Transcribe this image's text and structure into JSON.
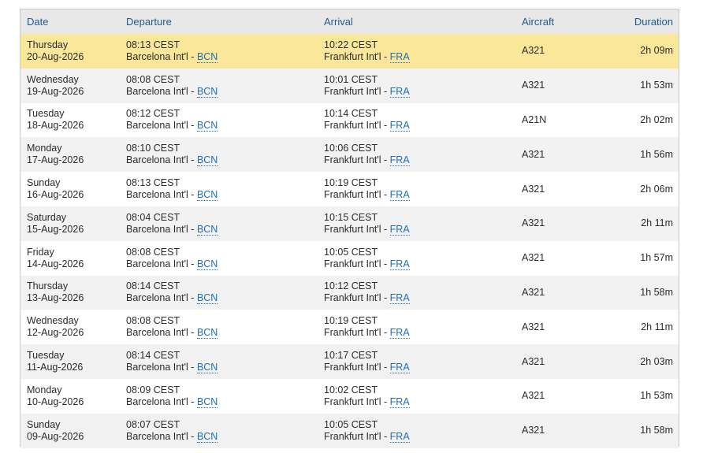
{
  "columns": {
    "date": "Date",
    "departure": "Departure",
    "arrival": "Arrival",
    "aircraft": "Aircraft",
    "duration": "Duration"
  },
  "colors": {
    "header_text": "#1d5a8e",
    "highlight_row": "#fbe79a",
    "link": "#1f6fb5"
  },
  "separator": " - ",
  "flights": [
    {
      "day": "Thursday",
      "date": "20-Aug-2026",
      "dep_time": "08:13 CEST",
      "dep_airport": "Barcelona Int'l",
      "dep_code": "BCN",
      "arr_time": "10:22 CEST",
      "arr_airport": "Frankfurt Int'l",
      "arr_code": "FRA",
      "aircraft": "A321",
      "duration": "2h 09m",
      "highlighted": true
    },
    {
      "day": "Wednesday",
      "date": "19-Aug-2026",
      "dep_time": "08:08 CEST",
      "dep_airport": "Barcelona Int'l",
      "dep_code": "BCN",
      "arr_time": "10:01 CEST",
      "arr_airport": "Frankfurt Int'l",
      "arr_code": "FRA",
      "aircraft": "A321",
      "duration": "1h 53m"
    },
    {
      "day": "Tuesday",
      "date": "18-Aug-2026",
      "dep_time": "08:12 CEST",
      "dep_airport": "Barcelona Int'l",
      "dep_code": "BCN",
      "arr_time": "10:14 CEST",
      "arr_airport": "Frankfurt Int'l",
      "arr_code": "FRA",
      "aircraft": "A21N",
      "duration": "2h 02m"
    },
    {
      "day": "Monday",
      "date": "17-Aug-2026",
      "dep_time": "08:10 CEST",
      "dep_airport": "Barcelona Int'l",
      "dep_code": "BCN",
      "arr_time": "10:06 CEST",
      "arr_airport": "Frankfurt Int'l",
      "arr_code": "FRA",
      "aircraft": "A321",
      "duration": "1h 56m"
    },
    {
      "day": "Sunday",
      "date": "16-Aug-2026",
      "dep_time": "08:13 CEST",
      "dep_airport": "Barcelona Int'l",
      "dep_code": "BCN",
      "arr_time": "10:19 CEST",
      "arr_airport": "Frankfurt Int'l",
      "arr_code": "FRA",
      "aircraft": "A321",
      "duration": "2h 06m"
    },
    {
      "day": "Saturday",
      "date": "15-Aug-2026",
      "dep_time": "08:04 CEST",
      "dep_airport": "Barcelona Int'l",
      "dep_code": "BCN",
      "arr_time": "10:15 CEST",
      "arr_airport": "Frankfurt Int'l",
      "arr_code": "FRA",
      "aircraft": "A321",
      "duration": "2h 11m"
    },
    {
      "day": "Friday",
      "date": "14-Aug-2026",
      "dep_time": "08:08 CEST",
      "dep_airport": "Barcelona Int'l",
      "dep_code": "BCN",
      "arr_time": "10:05 CEST",
      "arr_airport": "Frankfurt Int'l",
      "arr_code": "FRA",
      "aircraft": "A321",
      "duration": "1h 57m"
    },
    {
      "day": "Thursday",
      "date": "13-Aug-2026",
      "dep_time": "08:14 CEST",
      "dep_airport": "Barcelona Int'l",
      "dep_code": "BCN",
      "arr_time": "10:12 CEST",
      "arr_airport": "Frankfurt Int'l",
      "arr_code": "FRA",
      "aircraft": "A321",
      "duration": "1h 58m"
    },
    {
      "day": "Wednesday",
      "date": "12-Aug-2026",
      "dep_time": "08:08 CEST",
      "dep_airport": "Barcelona Int'l",
      "dep_code": "BCN",
      "arr_time": "10:19 CEST",
      "arr_airport": "Frankfurt Int'l",
      "arr_code": "FRA",
      "aircraft": "A321",
      "duration": "2h 11m"
    },
    {
      "day": "Tuesday",
      "date": "11-Aug-2026",
      "dep_time": "08:14 CEST",
      "dep_airport": "Barcelona Int'l",
      "dep_code": "BCN",
      "arr_time": "10:17 CEST",
      "arr_airport": "Frankfurt Int'l",
      "arr_code": "FRA",
      "aircraft": "A321",
      "duration": "2h 03m"
    },
    {
      "day": "Monday",
      "date": "10-Aug-2026",
      "dep_time": "08:09 CEST",
      "dep_airport": "Barcelona Int'l",
      "dep_code": "BCN",
      "arr_time": "10:02 CEST",
      "arr_airport": "Frankfurt Int'l",
      "arr_code": "FRA",
      "aircraft": "A321",
      "duration": "1h 53m"
    },
    {
      "day": "Sunday",
      "date": "09-Aug-2026",
      "dep_time": "08:07 CEST",
      "dep_airport": "Barcelona Int'l",
      "dep_code": "BCN",
      "arr_time": "10:05 CEST",
      "arr_airport": "Frankfurt Int'l",
      "arr_code": "FRA",
      "aircraft": "A321",
      "duration": "1h 58m"
    }
  ]
}
